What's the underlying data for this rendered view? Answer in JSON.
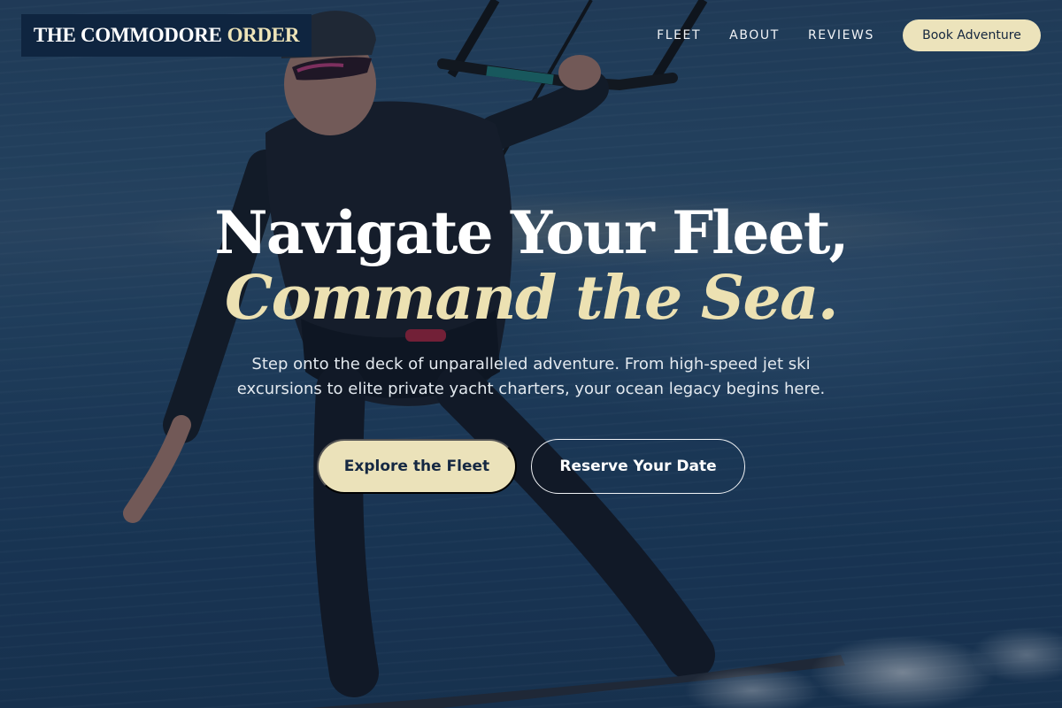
{
  "brand": {
    "primary": "THE COMMODORE",
    "accent": "ORDER"
  },
  "nav": {
    "items": [
      "FLEET",
      "ABOUT",
      "REVIEWS"
    ],
    "cta_label": "Book Adventure"
  },
  "hero": {
    "headline_line1": "Navigate Your Fleet,",
    "headline_line2": "Command the Sea.",
    "subtitle": "Step onto the deck of unparalleled adventure. From high-speed jet ski excursions to elite private yacht charters, your ocean legacy begins here.",
    "primary_cta": "Explore the Fleet",
    "secondary_cta": "Reserve Your Date"
  },
  "colors": {
    "navy": "#0f2540",
    "cream_accent": "#ece3bb",
    "ocean": "#2b5174"
  }
}
